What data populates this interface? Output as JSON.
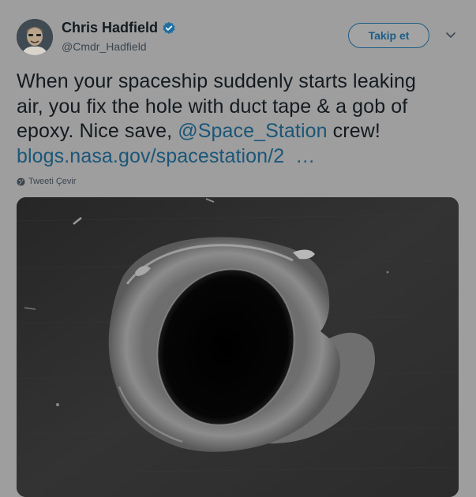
{
  "user": {
    "name": "Chris Hadfield",
    "handle": "@Cmdr_Hadfield"
  },
  "follow_button": "Takip et",
  "tweet": {
    "line1": "When your spaceship suddenly starts leaking",
    "line2": "air, you fix the hole with duct tape & a gob of",
    "line3_prefix": "epoxy. Nice save, ",
    "mention": "@Space_Station",
    "line3_suffix": " crew!",
    "link": "blogs.nasa.gov/spacestation/2",
    "ellipsis": "…"
  },
  "translate_label": "Tweeti Çevir",
  "icons": {
    "verified": "verified-badge-icon",
    "chevron": "chevron-down-icon",
    "globe": "globe-icon"
  },
  "colors": {
    "background": "#9e9e9e",
    "link": "#1a5678",
    "verified": "#1d6fa3",
    "button_border": "#1b5e86"
  }
}
